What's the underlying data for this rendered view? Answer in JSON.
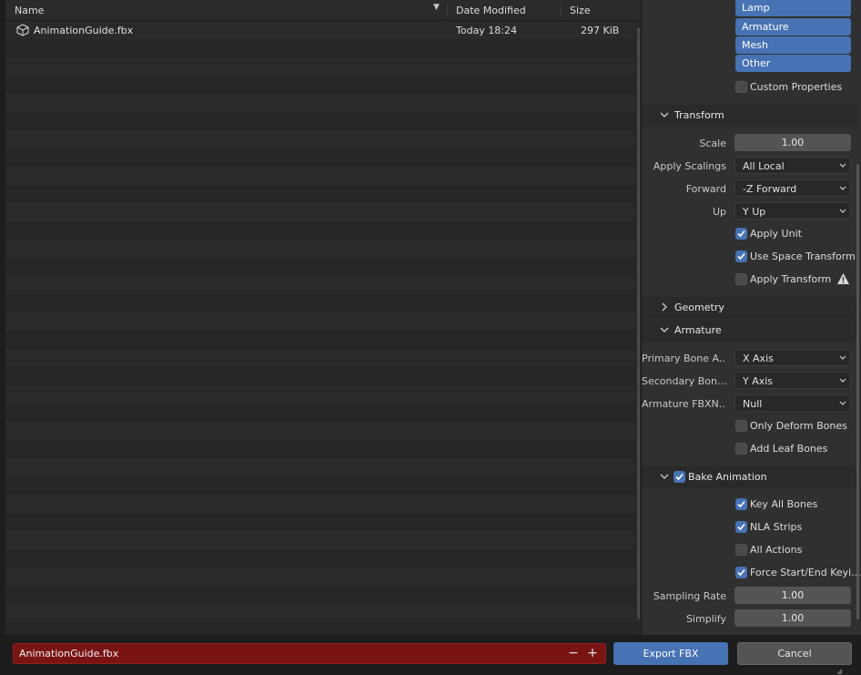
{
  "file_browser": {
    "columns": {
      "name": "Name",
      "date": "Date Modified",
      "size": "Size"
    },
    "files": [
      {
        "name": "AnimationGuide.fbx",
        "date": "Today 18:24",
        "size": "297 KiB",
        "icon": "cube-icon"
      }
    ]
  },
  "object_types": [
    "Lamp",
    "Armature",
    "Mesh",
    "Other"
  ],
  "custom_properties": {
    "label": "Custom Properties",
    "checked": false
  },
  "transform": {
    "title": "Transform",
    "scale_label": "Scale",
    "scale_value": "1.00",
    "apply_scalings_label": "Apply Scalings",
    "apply_scalings_value": "All Local",
    "forward_label": "Forward",
    "forward_value": "-Z Forward",
    "up_label": "Up",
    "up_value": "Y Up",
    "apply_unit": {
      "label": "Apply Unit",
      "checked": true
    },
    "use_space_transform": {
      "label": "Use Space Transform",
      "checked": true
    },
    "apply_transform": {
      "label": "Apply Transform",
      "checked": false
    }
  },
  "geometry": {
    "title": "Geometry"
  },
  "armature": {
    "title": "Armature",
    "primary_label": "Primary Bone A...",
    "primary_value": "X Axis",
    "secondary_label": "Secondary Bon...",
    "secondary_value": "Y Axis",
    "fbxnode_label": "Armature FBXN...",
    "fbxnode_value": "Null",
    "only_deform": {
      "label": "Only Deform Bones",
      "checked": false
    },
    "add_leaf": {
      "label": "Add Leaf Bones",
      "checked": false
    }
  },
  "bake_animation": {
    "title": "Bake Animation",
    "checked": true,
    "key_all_bones": {
      "label": "Key All Bones",
      "checked": true
    },
    "nla_strips": {
      "label": "NLA Strips",
      "checked": true
    },
    "all_actions": {
      "label": "All Actions",
      "checked": false
    },
    "force_start_end": {
      "label": "Force Start/End Keyi...",
      "checked": true
    },
    "sampling_rate_label": "Sampling Rate",
    "sampling_rate_value": "1.00",
    "simplify_label": "Simplify",
    "simplify_value": "1.00"
  },
  "bottom": {
    "filename": "AnimationGuide.fbx",
    "minus": "−",
    "plus": "+",
    "export_label": "Export FBX",
    "cancel_label": "Cancel"
  }
}
